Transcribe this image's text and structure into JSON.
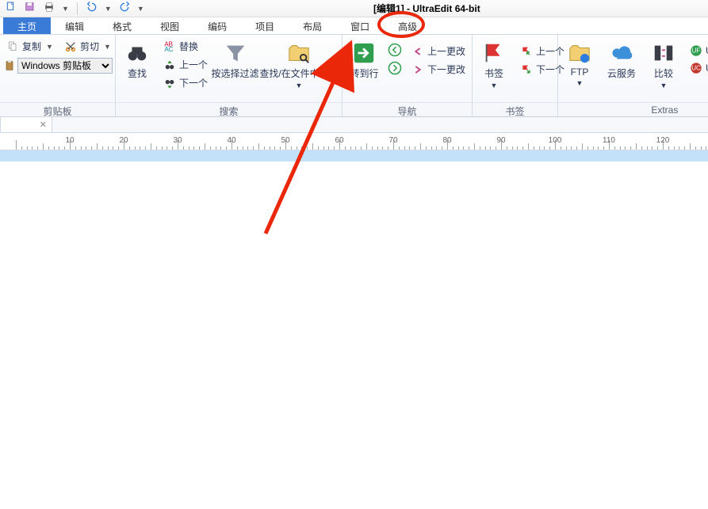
{
  "title": "[编辑1] - UltraEdit 64-bit",
  "menu": {
    "items": [
      "主页",
      "编辑",
      "格式",
      "视图",
      "编码",
      "项目",
      "布局",
      "窗口",
      "高级"
    ],
    "active": "主页",
    "highlighted": "高级"
  },
  "ribbon": {
    "clipboard": {
      "copy_label": "复制",
      "cut_label": "剪切",
      "select_value": "Windows 剪贴板",
      "group_title": "剪贴板"
    },
    "search": {
      "find_label": "查找",
      "replace_label": "替换",
      "prev_label": "上一个",
      "next_label": "下一个",
      "filter_label": "按选择过滤",
      "find_in_files_label": "查找/在文件中替换",
      "group_title": "搜索"
    },
    "nav": {
      "goto_label": "转到行",
      "prev_change_label": "上一更改",
      "next_change_label": "下一更改",
      "group_title": "导航"
    },
    "bookmark": {
      "bookmark_label": "书签",
      "prev_label": "上一个",
      "next_label": "下一个",
      "group_title": "书签"
    },
    "extras": {
      "ftp_label": "FTP",
      "cloud_label": "云服务",
      "compare_label": "比较",
      "ultrafinder_label": "UltraFinder",
      "ultracompare_label": "UltraCompare",
      "group_title": "Extras"
    }
  },
  "ruler": {
    "step": 10,
    "start": 10,
    "count": 12
  }
}
